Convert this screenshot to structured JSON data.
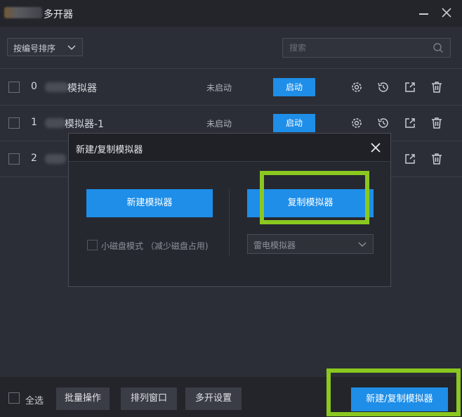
{
  "window": {
    "title": "多开器",
    "minimize_icon": "minimize-icon",
    "close_icon": "close-icon"
  },
  "toolbar": {
    "sort_label": "按编号排序",
    "search_placeholder": "搜索"
  },
  "instances": [
    {
      "index": "0",
      "name": "模拟器",
      "status": "未启动",
      "start_label": "启动"
    },
    {
      "index": "1",
      "name": "模拟器-1",
      "status": "未启动",
      "start_label": "启动"
    },
    {
      "index": "2",
      "name": "",
      "status": "",
      "start_label": ""
    }
  ],
  "dialog": {
    "title": "新建/复制模拟器",
    "new_button": "新建模拟器",
    "copy_button": "复制模拟器",
    "small_disk_label": "小磁盘模式 （减少磁盘占用)",
    "source_select": "雷电模拟器"
  },
  "footer": {
    "select_all": "全选",
    "batch_ops": "批量操作",
    "arrange_windows": "排列窗口",
    "multi_settings": "多开设置",
    "new_copy_button": "新建/复制模拟器"
  },
  "colors": {
    "accent": "#1e8ee8",
    "highlight": "#8ac820",
    "background": "#2b2e36"
  }
}
